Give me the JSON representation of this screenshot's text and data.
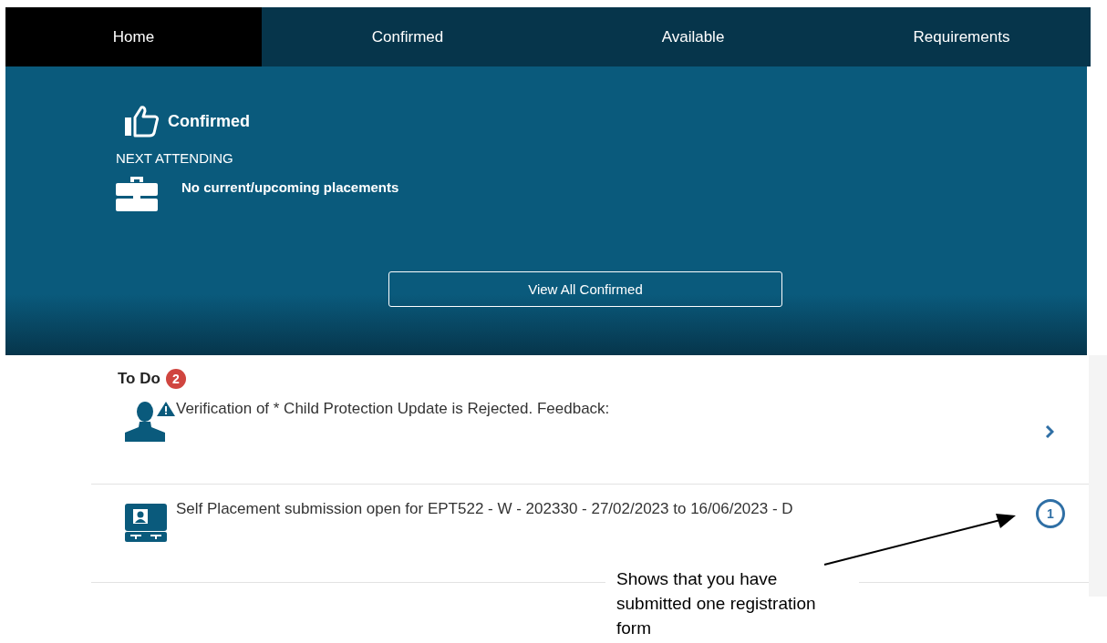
{
  "nav": {
    "tabs": [
      {
        "label": "Home",
        "selected": true
      },
      {
        "label": "Confirmed",
        "selected": false
      },
      {
        "label": "Available",
        "selected": false
      },
      {
        "label": "Requirements",
        "selected": false
      }
    ]
  },
  "confirmed": {
    "title": "Confirmed",
    "next_label": "NEXT ATTENDING",
    "placement": "No current/upcoming placements",
    "button": "View All Confirmed"
  },
  "todo": {
    "title": "To Do",
    "count": "2",
    "items": [
      {
        "kind": "alert",
        "text": "Verification of * Child Protection Update is Rejected. Feedback:"
      },
      {
        "kind": "submission",
        "text": "Self Placement submission open for EPT522 - W - 202330 - 27/02/2023 to 16/06/2023 - D",
        "count": "1"
      }
    ]
  },
  "annotation": {
    "text": "Shows that you have submitted one registration form"
  }
}
